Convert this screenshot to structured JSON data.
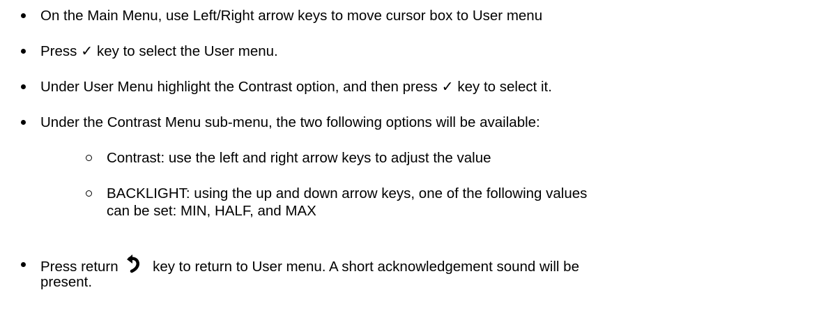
{
  "items": [
    {
      "text": "On the Main Menu, use Left/Right arrow keys to move cursor box to User menu"
    },
    {
      "text": "Press ✓ key to select the User menu."
    },
    {
      "text": "Under User Menu highlight the Contrast option, and then press ✓ key to select it."
    },
    {
      "text": "Under the Contrast Menu sub-menu, the two following options will be available:"
    }
  ],
  "subitems": [
    {
      "text": "Contrast: use the left and right arrow keys to adjust the value"
    },
    {
      "line1": "BACKLIGHT: using the up and down arrow keys, one of the following values",
      "line2": "can be set: MIN, HALF, and MAX"
    }
  ],
  "last_item": {
    "before": "Press return",
    "icon": "return-arrow-icon",
    "after": "key to return to User menu. A short acknowledgement sound will be",
    "line2": "present."
  }
}
